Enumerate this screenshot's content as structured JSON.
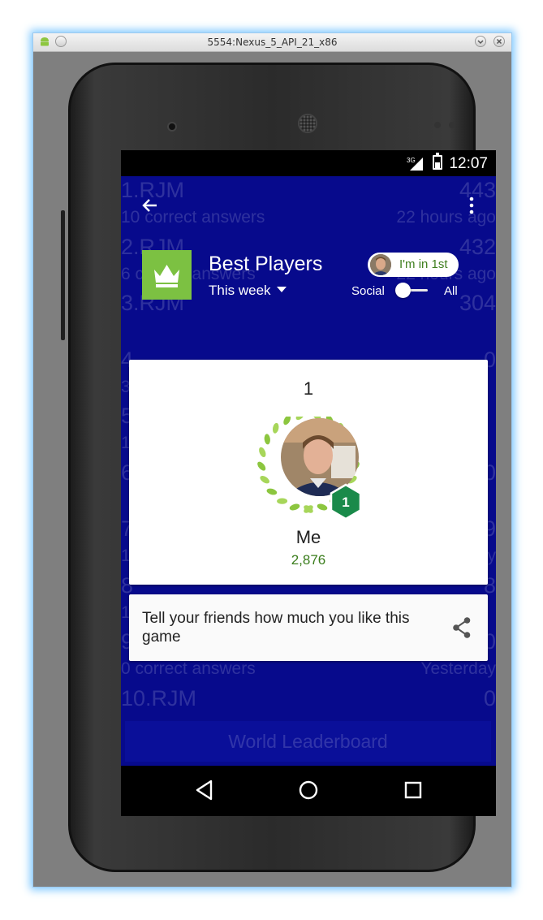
{
  "window": {
    "title": "5554:Nexus_5_API_21_x86"
  },
  "status_bar": {
    "network": "3G",
    "time": "12:07"
  },
  "background_leaderboard": {
    "rows": [
      {
        "name": "1.RJM",
        "score": "443",
        "sub": "10 correct answers",
        "time": "22 hours ago"
      },
      {
        "name": "2.RJM",
        "score": "432",
        "sub": "6 correct answers",
        "time": "22 hours ago"
      },
      {
        "name": "3.RJM",
        "score": "304",
        "sub": "",
        "time": ""
      },
      {
        "name": "4",
        "score": "0",
        "sub": "3",
        "time": ""
      },
      {
        "name": "5",
        "score": "",
        "sub": "1",
        "time": ""
      },
      {
        "name": "6",
        "score": "0",
        "sub": "",
        "time": ""
      },
      {
        "name": "7",
        "score": "9",
        "sub": "1 correct answers",
        "time": "Yesterday"
      },
      {
        "name": "8",
        "score": "8",
        "sub": "1",
        "time": ""
      },
      {
        "name": "9.RJM",
        "score": "0",
        "sub": "0 correct answers",
        "time": "Yesterday"
      },
      {
        "name": "10.RJM",
        "score": "0",
        "sub": "",
        "time": ""
      }
    ],
    "world_button": "World Leaderboard"
  },
  "header": {
    "title": "Best Players",
    "period": "This week",
    "rank_pill": "I'm in 1st",
    "toggle_left": "Social",
    "toggle_right": "All",
    "toggle_state": "Social"
  },
  "player_card": {
    "rank": "1",
    "badge": "1",
    "name": "Me",
    "score": "2,876"
  },
  "share_card": {
    "text": "Tell your friends how much you like this game"
  },
  "colors": {
    "background": "#070a8c",
    "accent_green": "#7cc142",
    "score_green": "#3a7d1c",
    "badge_green": "#1a8a4a"
  },
  "icons": [
    "back-arrow-icon",
    "overflow-menu-icon",
    "crown-icon",
    "share-icon",
    "nav-back-icon",
    "nav-home-icon",
    "nav-recents-icon"
  ]
}
